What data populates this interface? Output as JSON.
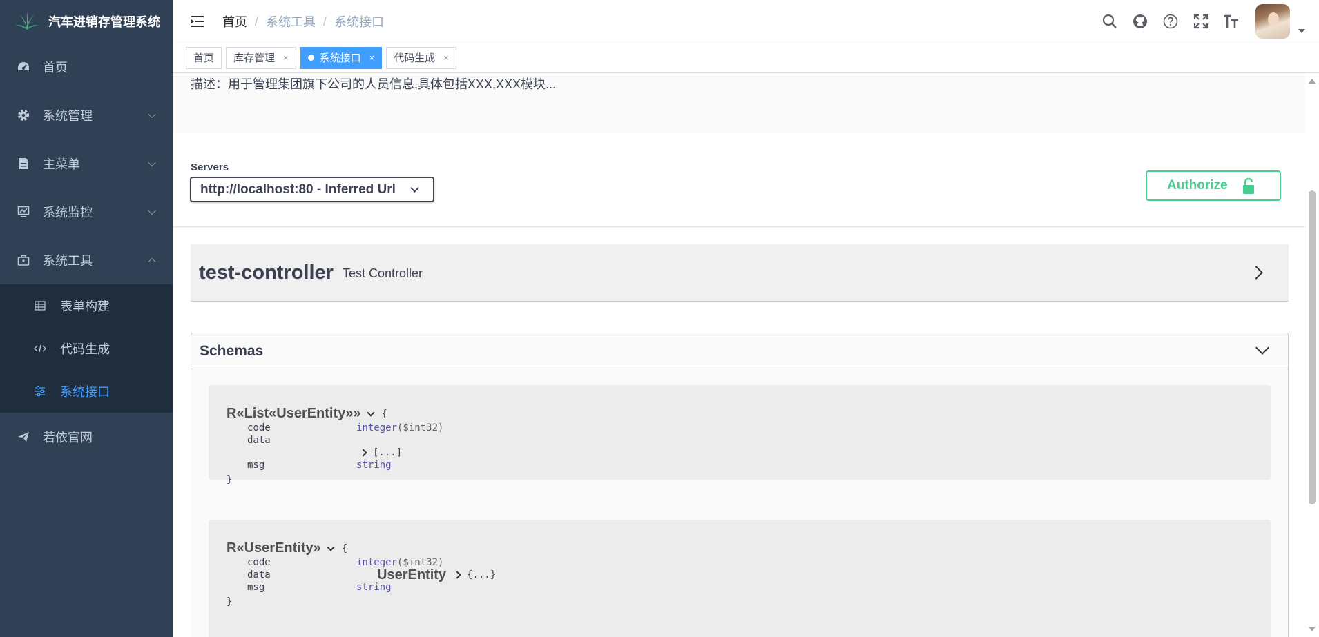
{
  "sidebar": {
    "logo_text": "汽车进销存管理系统",
    "items": [
      {
        "label": "首页",
        "icon": "dashboard-icon"
      },
      {
        "label": "系统管理",
        "icon": "gear-icon"
      },
      {
        "label": "主菜单",
        "icon": "document-icon"
      },
      {
        "label": "系统监控",
        "icon": "monitor-icon"
      },
      {
        "label": "系统工具",
        "icon": "toolbox-icon"
      }
    ],
    "sub_items": [
      {
        "label": "表单构建",
        "icon": "table-icon"
      },
      {
        "label": "代码生成",
        "icon": "code-icon"
      },
      {
        "label": "系统接口",
        "icon": "sliders-icon"
      }
    ],
    "bottom_item": {
      "label": "若依官网",
      "icon": "paper-plane-icon"
    },
    "colors": {
      "background": "#304156",
      "submenu": "#1f2d3d",
      "active": "#409eff"
    }
  },
  "navbar": {
    "breadcrumb": [
      "首页",
      "系统工具",
      "系统接口"
    ],
    "breadcrumb_sep": "/",
    "icons": [
      "search-icon",
      "github-icon",
      "help-icon",
      "fullscreen-icon",
      "font-size-icon"
    ]
  },
  "tags": [
    {
      "label": "首页",
      "closable": false,
      "active": false
    },
    {
      "label": "库存管理",
      "closable": true,
      "active": false
    },
    {
      "label": "系统接口",
      "closable": true,
      "active": true
    },
    {
      "label": "代码生成",
      "closable": true,
      "active": false
    }
  ],
  "tag_close": "×",
  "swagger": {
    "description": "描述：用于管理集团旗下公司的人员信息,具体包括XXX,XXX模块...",
    "servers_label": "Servers",
    "server_value": "http://localhost:80 - Inferred Url",
    "authorize_label": "Authorize",
    "tag_name": "test-controller",
    "tag_description": "Test Controller",
    "schemas_label": "Schemas",
    "models": [
      {
        "title": "R«List«UserEntity»»",
        "open_brace": "{",
        "close_brace": "}",
        "props": [
          {
            "name": "code",
            "type": "integer",
            "format": "($int32)"
          },
          {
            "name": "data",
            "inner": "[...]"
          },
          {
            "name": "msg",
            "type": "string"
          }
        ]
      },
      {
        "title": "R«UserEntity»",
        "open_brace": "{",
        "close_brace": "}",
        "props": [
          {
            "name": "code",
            "type": "integer",
            "format": "($int32)"
          },
          {
            "name": "data",
            "inner_name": "UserEntity",
            "inner": "{...}"
          },
          {
            "name": "msg",
            "type": "string"
          }
        ]
      }
    ],
    "colors": {
      "authorize": "#49cc90",
      "type": "#5555aa"
    }
  }
}
